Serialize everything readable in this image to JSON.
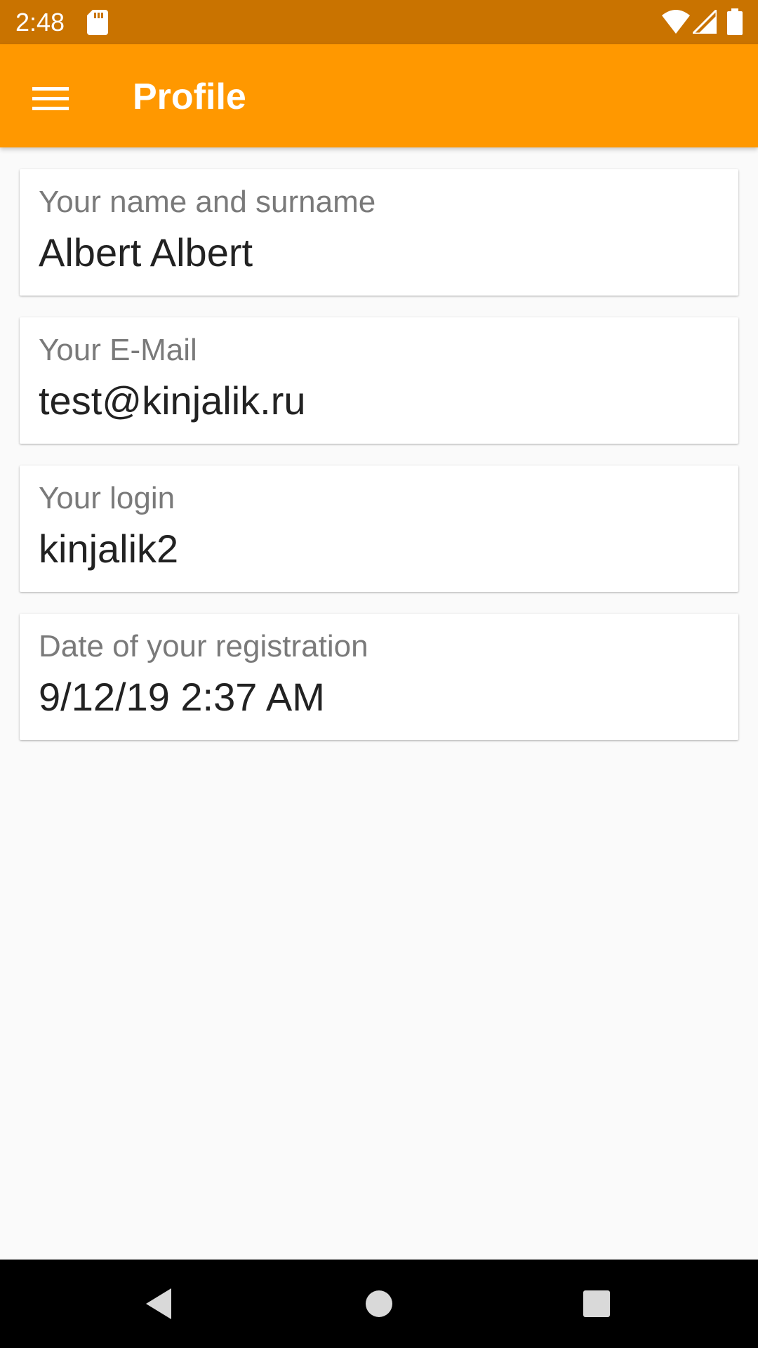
{
  "status_bar": {
    "time": "2:48",
    "icons": [
      "sd-card-icon",
      "wifi-icon",
      "signal-icon",
      "battery-icon"
    ]
  },
  "app_bar": {
    "title": "Profile",
    "menu_icon": "hamburger-menu-icon",
    "color": "#ff9800"
  },
  "profile": {
    "fields": [
      {
        "label": "Your name and surname",
        "value": "Albert Albert"
      },
      {
        "label": "Your E-Mail",
        "value": "test@kinjalik.ru"
      },
      {
        "label": "Your login",
        "value": "kinjalik2"
      },
      {
        "label": "Date of your registration",
        "value": "9/12/19 2:37 AM"
      }
    ]
  },
  "nav_bar": {
    "buttons": [
      "back-icon",
      "home-icon",
      "recents-icon"
    ]
  }
}
